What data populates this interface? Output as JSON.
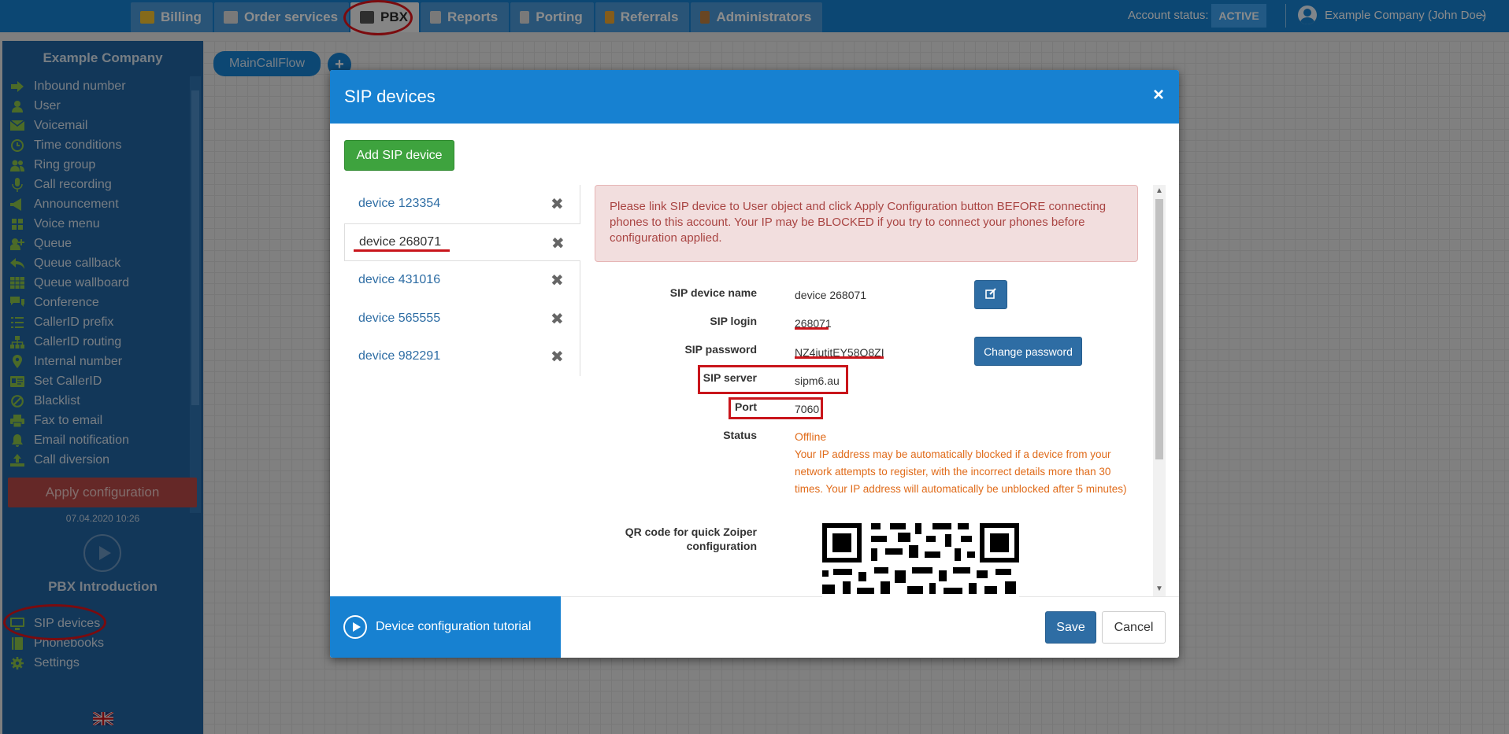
{
  "topbar": {
    "tabs": [
      {
        "label": "Billing",
        "icon": "coins-icon",
        "color": "#f2c230"
      },
      {
        "label": "Order services",
        "icon": "cart-icon",
        "color": "#dcdcdc"
      },
      {
        "label": "PBX",
        "icon": "pbx-phone-icon",
        "color": "#555555"
      },
      {
        "label": "Reports",
        "icon": "report-icon",
        "color": "#dcdcdc"
      },
      {
        "label": "Porting",
        "icon": "porting-icon",
        "color": "#dcdcdc"
      },
      {
        "label": "Referrals",
        "icon": "referral-icon",
        "color": "#f0a830"
      },
      {
        "label": "Administrators",
        "icon": "admin-icon",
        "color": "#c08040"
      }
    ],
    "active_tab": "PBX",
    "account_status_label": "Account status:",
    "account_status_value": "ACTIVE",
    "user_name": "Example Company (John Doe)",
    "user_chevron": "⌄"
  },
  "sidebar": {
    "company": "Example Company",
    "items": [
      {
        "label": "Inbound number",
        "icon": "arrow-right-icon"
      },
      {
        "label": "User",
        "icon": "user-icon"
      },
      {
        "label": "Voicemail",
        "icon": "envelope-icon"
      },
      {
        "label": "Time conditions",
        "icon": "clock-icon"
      },
      {
        "label": "Ring group",
        "icon": "users-icon"
      },
      {
        "label": "Call recording",
        "icon": "microphone-icon"
      },
      {
        "label": "Announcement",
        "icon": "megaphone-icon"
      },
      {
        "label": "Voice menu",
        "icon": "grid-icon"
      },
      {
        "label": "Queue",
        "icon": "user-plus-icon"
      },
      {
        "label": "Queue callback",
        "icon": "reply-icon"
      },
      {
        "label": "Queue wallboard",
        "icon": "table-icon"
      },
      {
        "label": "Conference",
        "icon": "comments-icon"
      },
      {
        "label": "CallerID prefix",
        "icon": "list-icon"
      },
      {
        "label": "CallerID routing",
        "icon": "sitemap-icon"
      },
      {
        "label": "Internal number",
        "icon": "map-marker-icon"
      },
      {
        "label": "Set CallerID",
        "icon": "id-card-icon"
      },
      {
        "label": "Blacklist",
        "icon": "ban-icon"
      },
      {
        "label": "Fax to email",
        "icon": "printer-icon"
      },
      {
        "label": "Email notification",
        "icon": "bell-icon"
      },
      {
        "label": "Call diversion",
        "icon": "upload-icon"
      }
    ],
    "apply_label": "Apply configuration",
    "apply_date": "07.04.2020 10:26",
    "intro_label": "PBX Introduction",
    "bottom_items": [
      {
        "label": "SIP devices",
        "icon": "monitor-icon"
      },
      {
        "label": "Phonebooks",
        "icon": "book-icon"
      },
      {
        "label": "Settings",
        "icon": "gear-icon"
      }
    ],
    "icon_color": "#8bc34a"
  },
  "canvas": {
    "flow_tab": "MainCallFlow",
    "add_symbol": "+"
  },
  "modal": {
    "title": "SIP devices",
    "close_symbol": "×",
    "add_button": "Add SIP device",
    "devices": [
      {
        "name": "device 123354",
        "selected": false
      },
      {
        "name": "device 268071",
        "selected": true
      },
      {
        "name": "device 431016",
        "selected": false
      },
      {
        "name": "device 565555",
        "selected": false
      },
      {
        "name": "device 982291",
        "selected": false
      }
    ],
    "delete_symbol": "✖",
    "alert": "Please link SIP device to User object and click Apply Configuration button BEFORE connecting phones to this account. Your IP may be BLOCKED if you try to connect your phones before configuration applied.",
    "fields": {
      "device_name_label": "SIP device name",
      "device_name_value": "device 268071",
      "login_label": "SIP login",
      "login_value": "268071",
      "password_label": "SIP password",
      "password_value": "NZ4jutitEY58Q8ZI",
      "server_label": "SIP server",
      "server_value": "sipm6.au",
      "port_label": "Port",
      "port_value": "7060",
      "status_label": "Status",
      "status_value": "Offline",
      "status_note": "Your IP address may be automatically blocked if a device from your network attempts to register, with the incorrect details more than 30 times. Your IP address will automatically be unblocked after 5 minutes)",
      "qr_label": "QR code for quick Zoiper configuration"
    },
    "change_password_button": "Change password",
    "tutorial_label": "Device configuration tutorial",
    "save_button": "Save",
    "cancel_button": "Cancel",
    "colors": {
      "primary": "#1781d1",
      "button_blue": "#2e6da4",
      "success": "#3ea33e",
      "alert_text": "#a94442",
      "status_text": "#e06b1a",
      "annotation_red": "#c9151b"
    }
  }
}
